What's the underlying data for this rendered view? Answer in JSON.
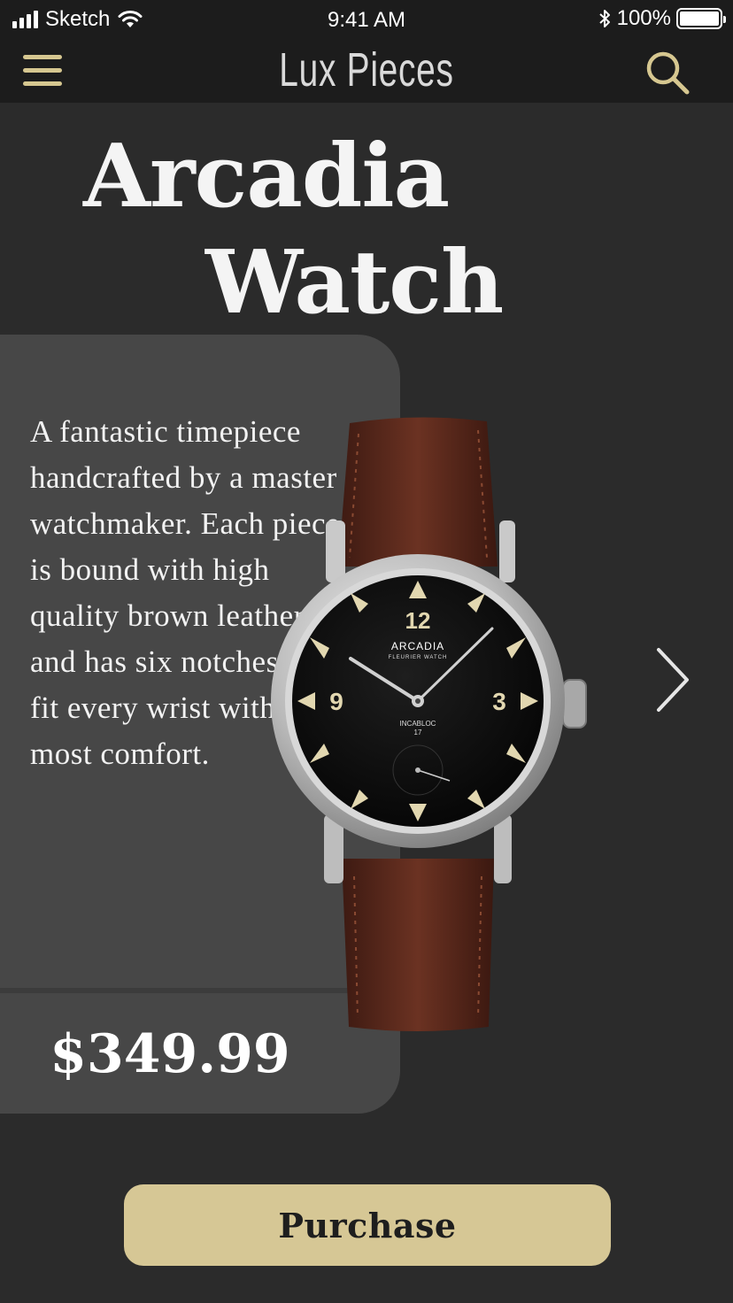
{
  "status_bar": {
    "carrier": "Sketch",
    "time": "9:41 AM",
    "battery": "100%"
  },
  "header": {
    "title": "Lux Pieces",
    "menu_icon": "hamburger-menu-icon",
    "search_icon": "search-icon"
  },
  "product": {
    "title_line1": "Arcadia",
    "title_line2": "Watch",
    "description": "A fantastic timepiece handcrafted by a master watchmaker. Each piece is bound with high quality brown leather and has six notches to fit every wrist with the most comfort.",
    "price": "$349.99",
    "watch_brand": "ARCADIA",
    "watch_sub": "FLEURIER WATCH",
    "watch_mark": "INCABLOC",
    "watch_jewels": "17",
    "numeral_12": "12",
    "numeral_9": "9",
    "numeral_3": "3"
  },
  "actions": {
    "purchase_label": "Purchase",
    "next_icon": "chevron-right-icon"
  },
  "colors": {
    "accent": "#d6c795",
    "background": "#2b2b2b",
    "card": "#474747",
    "bar": "#1c1c1c"
  }
}
